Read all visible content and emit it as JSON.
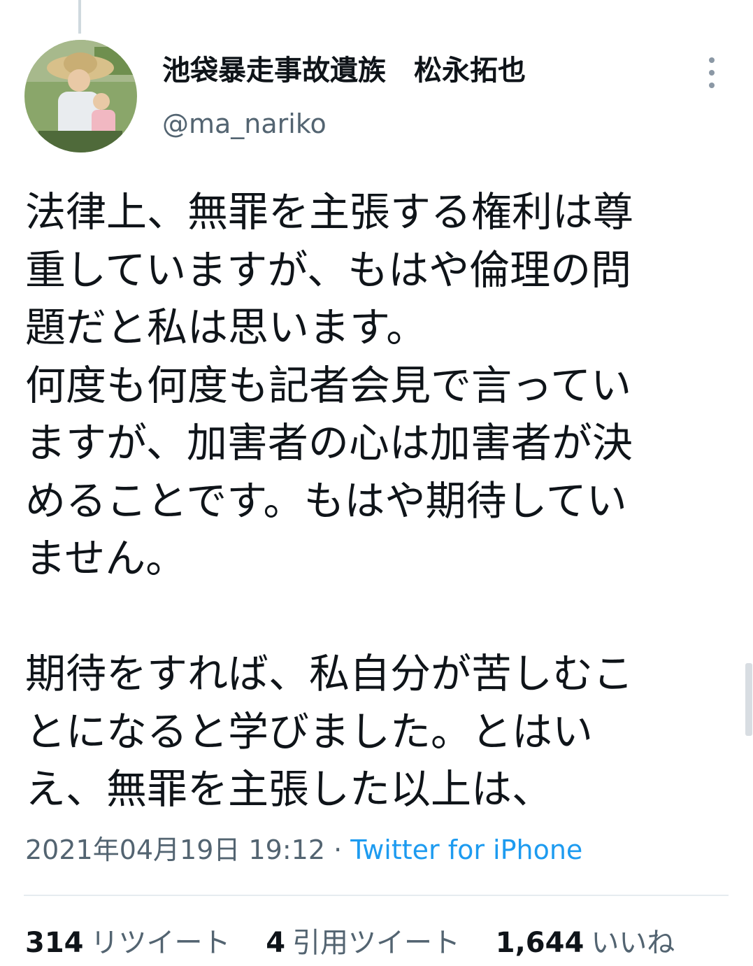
{
  "tweet": {
    "display_name": "池袋暴走事故遺族　松永拓也",
    "handle": "@ma_nariko",
    "text_lines": [
      "法律上、無罪を主張する権利は尊",
      "重していますが、もはや倫理の問",
      "題だと私は思います。",
      "何度も何度も記者会見で言ってい",
      "ますが、加害者の心は加害者が決",
      "めることです。もはや期待してい",
      "ません。",
      "",
      "期待をすれば、私自分が苦しむこ",
      "とになると学びました。とはい",
      "え、無罪を主張した以上は、"
    ],
    "timestamp": "2021年04月19日 19:12",
    "separator": " · ",
    "source": "Twitter for iPhone"
  },
  "stats": {
    "retweets": {
      "count": "314",
      "label": "リツイート"
    },
    "quotes": {
      "count": "4",
      "label": "引用ツイート"
    },
    "likes": {
      "count": "1,644",
      "label": "いいね"
    }
  },
  "icons": {
    "more": "more-vertical-icon"
  },
  "colors": {
    "text": "#0f1419",
    "secondary": "#536471",
    "link": "#1d9bf0",
    "divider": "#e6ecf0"
  }
}
